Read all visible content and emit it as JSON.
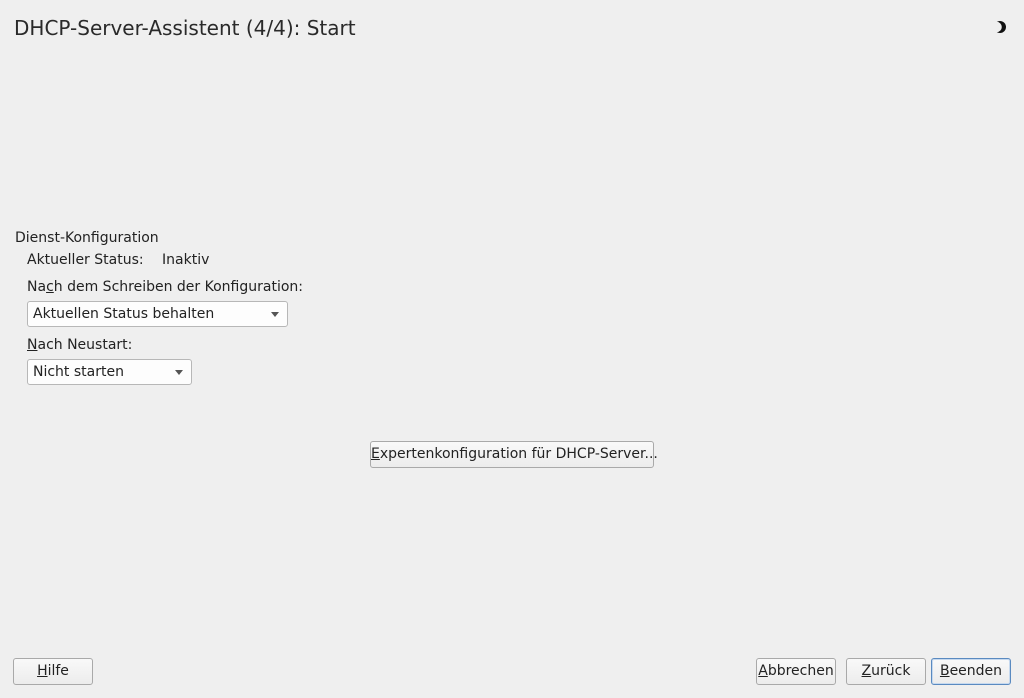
{
  "window": {
    "title": "DHCP-Server-Assistent (4/4): Start"
  },
  "service": {
    "section_title": "Dienst-Konfiguration",
    "current_status_label": "Aktueller Status:",
    "current_status_value": "Inaktiv",
    "after_write": {
      "label_pre": "Na",
      "label_mnemonic": "c",
      "label_post": "h dem Schreiben der Konfiguration:",
      "selected": "Aktuellen Status behalten"
    },
    "after_reboot": {
      "label_mnemonic": "N",
      "label_post": "ach Neustart:",
      "selected": "Nicht starten"
    }
  },
  "expert_button": {
    "mnemonic": "E",
    "rest": "xpertenkonfiguration für DHCP-Server..."
  },
  "footer": {
    "help": {
      "mnemonic": "H",
      "rest": "ilfe"
    },
    "abort": {
      "mnemonic": "A",
      "rest": "bbrechen"
    },
    "back": {
      "mnemonic": "Z",
      "rest": "urück"
    },
    "finish": {
      "mnemonic": "B",
      "rest": "eenden"
    }
  },
  "icons": {
    "theme": "moon-icon",
    "dropdown": "chevron-down-icon"
  }
}
